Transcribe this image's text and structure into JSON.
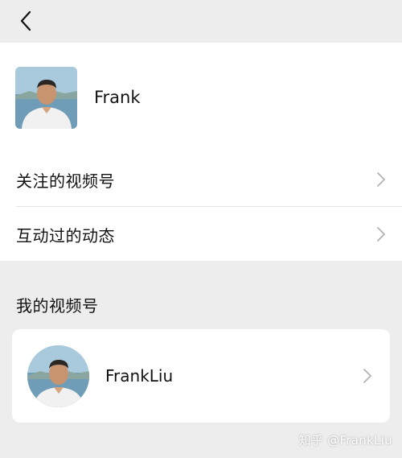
{
  "header": {
    "back_icon": "chevron-left-icon"
  },
  "profile": {
    "name": "Frank",
    "avatar_icon": "user-photo"
  },
  "menu": {
    "items": [
      {
        "label": "关注的视频号",
        "icon": "chevron-right-icon"
      },
      {
        "label": "互动过的动态",
        "icon": "chevron-right-icon"
      }
    ]
  },
  "my_channels": {
    "title": "我的视频号",
    "account": {
      "name": "FrankLiu",
      "avatar_icon": "user-photo"
    }
  },
  "watermark": "知乎 @FrankLiu",
  "colors": {
    "background": "#ededed",
    "panel": "#ffffff",
    "chevron": "#b2b2b2"
  }
}
